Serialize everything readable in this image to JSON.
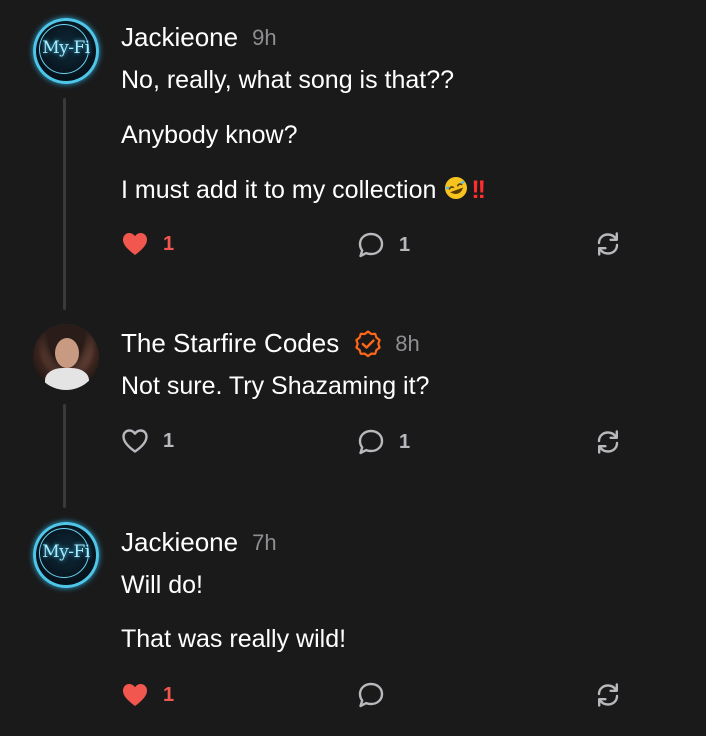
{
  "comments": [
    {
      "author": "Jackieone",
      "time": "9h",
      "avatar_text": "My-Fi",
      "lines": [
        "No, really, what song is that??",
        "Anybody know?",
        "I must add it to my collection"
      ],
      "trailing_emoji": "🤣",
      "trailing_marks": "!!",
      "likes": "1",
      "liked": true,
      "replies": "1"
    },
    {
      "author": "The Starfire Codes",
      "time": "8h",
      "verified": true,
      "lines": [
        "Not sure. Try Shazaming it?"
      ],
      "likes": "1",
      "liked": false,
      "replies": "1"
    },
    {
      "author": "Jackieone",
      "time": "7h",
      "avatar_text": "My-Fi",
      "lines": [
        "Will do!",
        "That was really wild!"
      ],
      "likes": "1",
      "liked": true,
      "replies": ""
    }
  ],
  "icons": {
    "like": "heart-icon",
    "reply": "speech-bubble-icon",
    "restack": "restack-icon",
    "verified": "verified-badge-icon"
  },
  "colors": {
    "background": "#1a1a1b",
    "liked": "#f2574f",
    "verified": "#ff6719",
    "muted": "#8e8e93"
  }
}
